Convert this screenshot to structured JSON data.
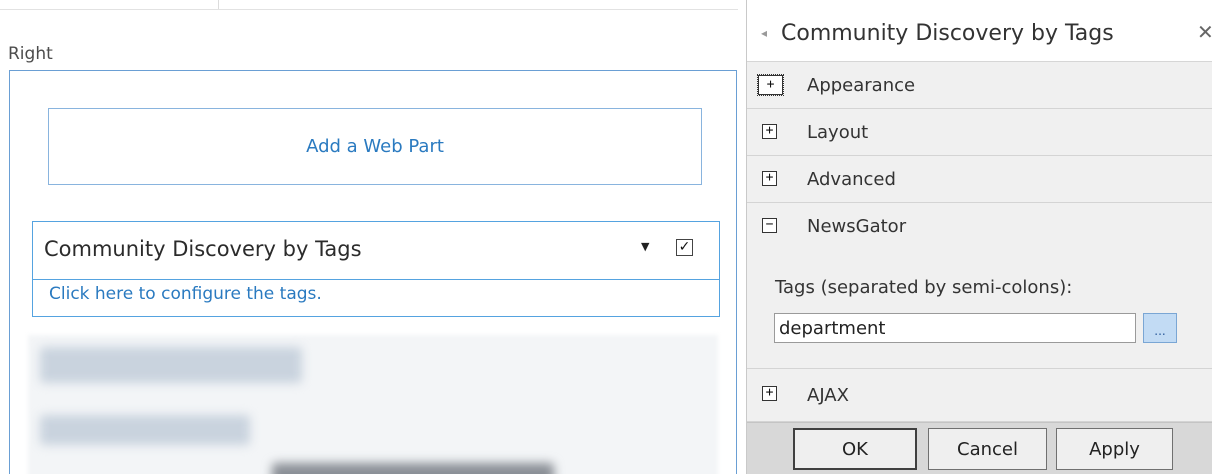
{
  "zone": {
    "label": "Right",
    "add_webpart": "Add a Web Part"
  },
  "webpart": {
    "title": "Community Discovery by Tags",
    "menu_icon": "dropdown-arrow-icon",
    "checkbox_checked": true,
    "checkbox_glyph": "✓",
    "configure_link": "Click here to configure the tags."
  },
  "pane": {
    "title": "Community Discovery by Tags",
    "back_icon": "◂",
    "close_icon": "✕",
    "sections": [
      {
        "label": "Appearance",
        "expander": "+",
        "expanded": false
      },
      {
        "label": "Layout",
        "expander": "+",
        "expanded": false
      },
      {
        "label": "Advanced",
        "expander": "+",
        "expanded": false
      },
      {
        "label": "NewsGator",
        "expander": "−",
        "expanded": true
      },
      {
        "label": "AJAX",
        "expander": "+",
        "expanded": false
      }
    ],
    "newsgator": {
      "tags_label": "Tags (separated by semi-colons):",
      "tags_value": "department",
      "browse_button": "..."
    },
    "buttons": {
      "ok": "OK",
      "cancel": "Cancel",
      "apply": "Apply"
    }
  },
  "colors": {
    "link": "#2a7ac0",
    "zone_border": "#6a9fd4",
    "pane_background": "#f0f0f0",
    "button_bar": "#d8d8d8"
  }
}
